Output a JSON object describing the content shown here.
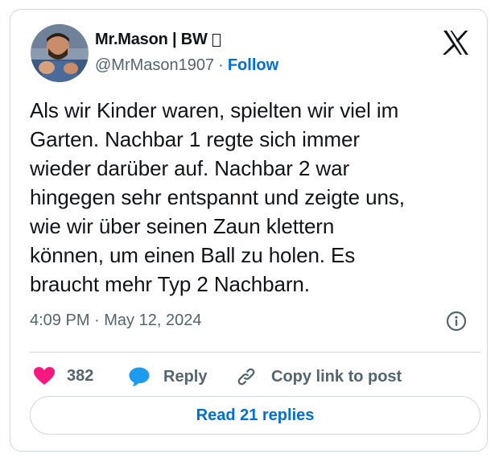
{
  "author": {
    "display_name": "Mr.Mason | BW",
    "handle": "@MrMason1907",
    "separator": "·",
    "follow_label": "Follow"
  },
  "tweet": {
    "text": "Als wir Kinder waren, spielten wir viel im\nGarten. Nachbar 1 regte sich immer\nwieder darüber auf. Nachbar 2 war\nhingegen sehr entspannt und zeigte uns,\nwie wir über seinen Zaun klettern\nkönnen, um einen Ball zu holen. Es\nbraucht mehr Typ 2 Nachbarn.",
    "timestamp": "4:09 PM · May 12, 2024"
  },
  "actions": {
    "like_count": "382",
    "reply_label": "Reply",
    "copy_link_label": "Copy link to post",
    "read_replies_label": "Read 21 replies"
  },
  "colors": {
    "link_blue": "#006fd6",
    "like_pink": "#f91880",
    "reply_blue": "#1d9bf0",
    "secondary_text": "#536471",
    "border": "#cfd9de"
  },
  "icons": {
    "brand": "x-logo-icon",
    "info": "info-icon",
    "like": "heart-icon",
    "reply": "speech-bubble-icon",
    "copy": "link-icon"
  }
}
